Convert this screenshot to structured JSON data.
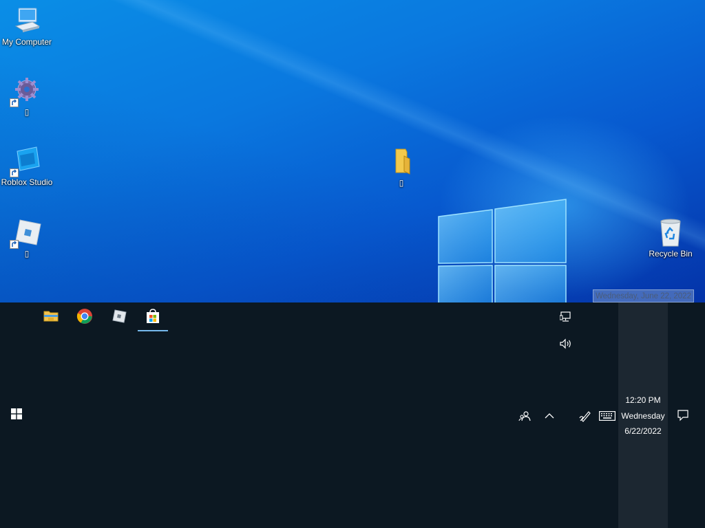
{
  "desktop": {
    "icons": [
      {
        "name": "my-computer",
        "label": "My Computer"
      },
      {
        "name": "settings-shortcut",
        "label": "▯"
      },
      {
        "name": "roblox-studio",
        "label": "Roblox Studio"
      },
      {
        "name": "roblox-player",
        "label": "▯"
      },
      {
        "name": "folder",
        "label": "▯"
      },
      {
        "name": "recycle-bin",
        "label": "Recycle Bin"
      }
    ],
    "date_tooltip": "Wednesday, June 22, 2022"
  },
  "taskbar": {
    "apps": [
      {
        "name": "file-explorer",
        "icon": "folder-icon"
      },
      {
        "name": "chrome",
        "icon": "chrome-icon"
      },
      {
        "name": "roblox",
        "icon": "roblox-icon"
      },
      {
        "name": "microsoft-store",
        "icon": "store-icon",
        "active": true
      }
    ],
    "tray": {
      "network_icon": "network-icon",
      "volume_icon": "volume-icon",
      "people_icon": "people-icon",
      "chevron_icon": "chevron-up-icon",
      "pen_icon": "pen-icon",
      "keyboard_icon": "keyboard-icon",
      "notification_icon": "action-center-icon"
    },
    "clock": {
      "time": "12:20 PM",
      "day": "Wednesday",
      "date": "6/22/2022"
    }
  },
  "colors": {
    "desktop_blue": "#0a78df",
    "taskbar_bg": "#0c1822",
    "active_underline": "#76b9ed"
  }
}
